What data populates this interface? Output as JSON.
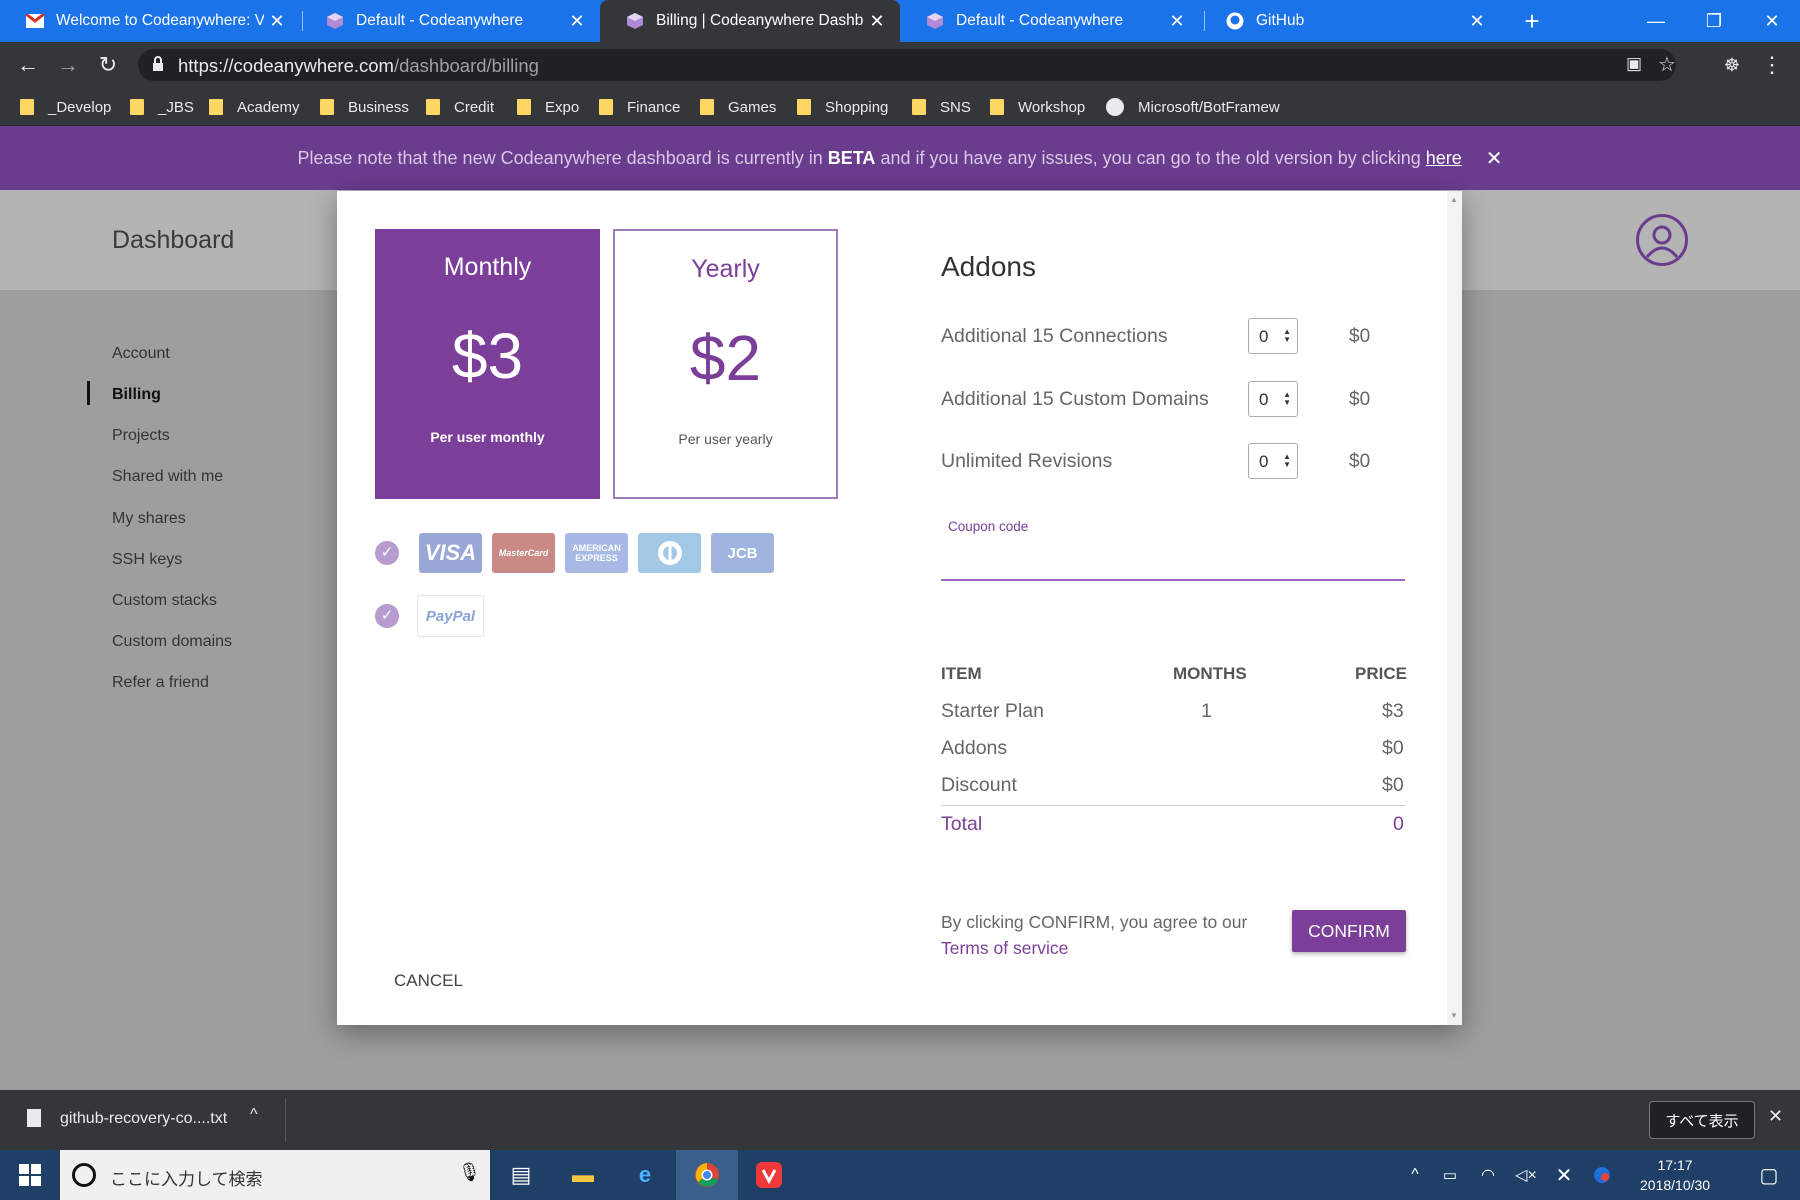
{
  "browser": {
    "tabs": [
      {
        "title": "Welcome to Codeanywhere: Veri"
      },
      {
        "title": "Default - Codeanywhere"
      },
      {
        "title": "Billing | Codeanywhere Dashboar"
      },
      {
        "title": "Default - Codeanywhere"
      },
      {
        "title": "GitHub"
      }
    ],
    "url_host": "https://codeanywhere.com",
    "url_path": "/dashboard/billing",
    "bookmarks": [
      "_Develop",
      "_JBS",
      "Academy",
      "Business",
      "Credit",
      "Expo",
      "Finance",
      "Games",
      "Shopping",
      "SNS",
      "Workshop",
      "Microsoft/BotFramew"
    ]
  },
  "banner": {
    "text_before": "Please note that the new Codeanywhere dashboard is currently in ",
    "beta": "BETA",
    "text_middle": " and if you have any issues, you can go to the old version by clicking ",
    "link": "here"
  },
  "dashboard": {
    "title": "Dashboard",
    "sidebar": [
      "Account",
      "Billing",
      "Projects",
      "Shared with me",
      "My shares",
      "SSH keys",
      "Custom stacks",
      "Custom domains",
      "Refer a friend"
    ]
  },
  "modal": {
    "plans": {
      "monthly": {
        "name": "Monthly",
        "price": "$3",
        "sub": "Per user monthly"
      },
      "yearly": {
        "name": "Yearly",
        "price": "$2",
        "sub": "Per user yearly"
      }
    },
    "cards": [
      "VISA",
      "MasterCard",
      "AMERICAN EXPRESS",
      "Diners",
      "JCB"
    ],
    "paypal": "PayPal",
    "cancel": "CANCEL",
    "addons_title": "Addons",
    "addons": [
      {
        "label": "Additional 15 Connections",
        "qty": "0",
        "price": "$0"
      },
      {
        "label": "Additional 15 Custom Domains",
        "qty": "0",
        "price": "$0"
      },
      {
        "label": "Unlimited Revisions",
        "qty": "0",
        "price": "$0"
      }
    ],
    "coupon_label": "Coupon code",
    "summary": {
      "headers": {
        "item": "ITEM",
        "months": "MONTHS",
        "price": "PRICE"
      },
      "rows": [
        {
          "item": "Starter Plan",
          "months": "1",
          "price": "$3"
        },
        {
          "item": "Addons",
          "months": "",
          "price": "$0"
        },
        {
          "item": "Discount",
          "months": "",
          "price": "$0"
        }
      ],
      "total_label": "Total",
      "total_value": "0"
    },
    "agree_text": "By clicking CONFIRM, you agree to our",
    "terms_link": "Terms of service",
    "confirm": "CONFIRM"
  },
  "downloads": {
    "file": "github-recovery-co....txt",
    "show_all": "すべて表示"
  },
  "taskbar": {
    "search_placeholder": "ここに入力して検索",
    "time": "17:17",
    "date": "2018/10/30"
  },
  "colors": {
    "brand_purple": "#7b3f99",
    "banner_purple": "#6a3c8e",
    "chrome_blue": "#1a73e8"
  }
}
